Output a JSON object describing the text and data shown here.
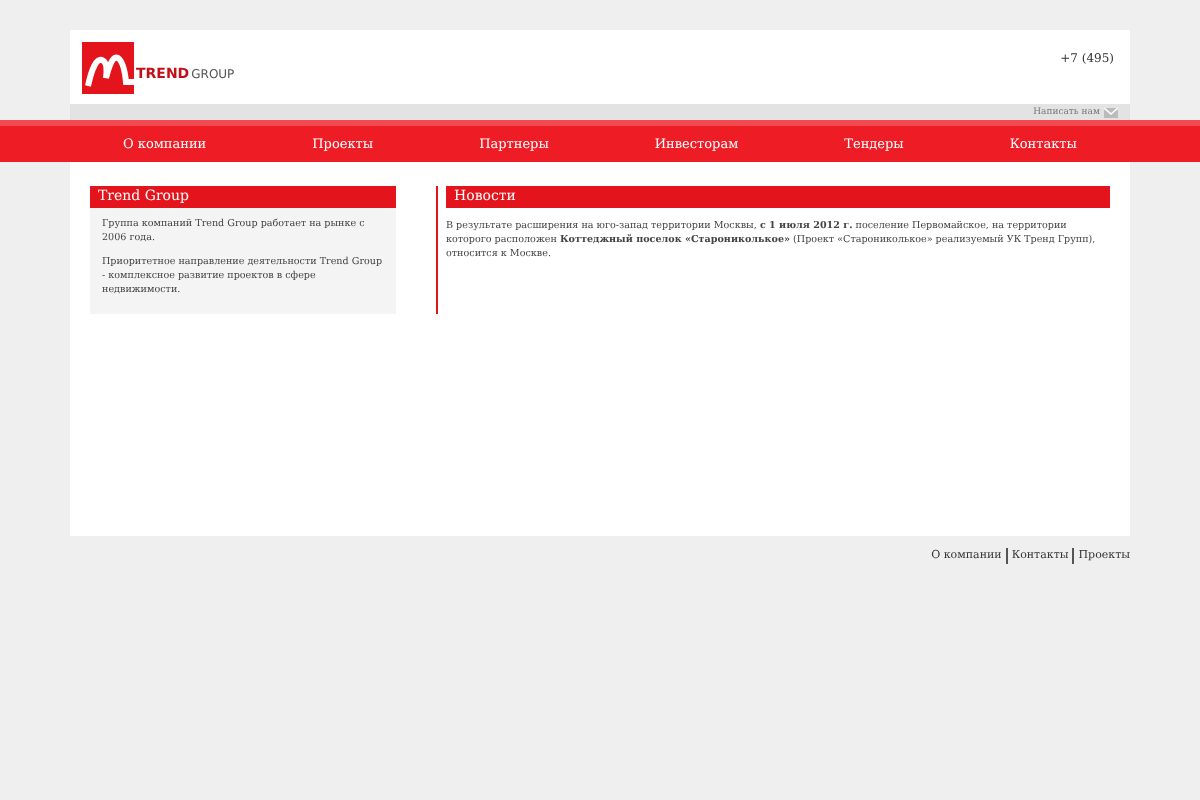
{
  "header": {
    "logo": {
      "brand": "TREND",
      "brand_suffix": "GROUP"
    },
    "phone": "+7 (495)",
    "write_link": "Написать нам"
  },
  "nav": [
    {
      "label": "О компании"
    },
    {
      "label": "Проекты"
    },
    {
      "label": "Партнеры"
    },
    {
      "label": "Инвесторам"
    },
    {
      "label": "Тендеры"
    },
    {
      "label": "Контакты"
    }
  ],
  "about": {
    "title": "Trend Group",
    "paragraphs": [
      "Группа компаний Trend Group работает на рынке с 2006 года.",
      "Приоритетное направление деятельности Trend Group - комплексное развитие проектов в сфере недвижимости."
    ]
  },
  "news": {
    "title": "Новости",
    "text": "В результате расширения на юго-запад  территории Москвы, **с 1 июля 2012 г.** поселение Первомайское,  на территории которого расположен **Коттеджный поселок «Старониколькое»** (Проект «Старониколькое» реализуемый УК Тренд Групп),  относится к Москве."
  },
  "footer_links": [
    "О компании",
    "Контакты",
    "Проекты"
  ]
}
